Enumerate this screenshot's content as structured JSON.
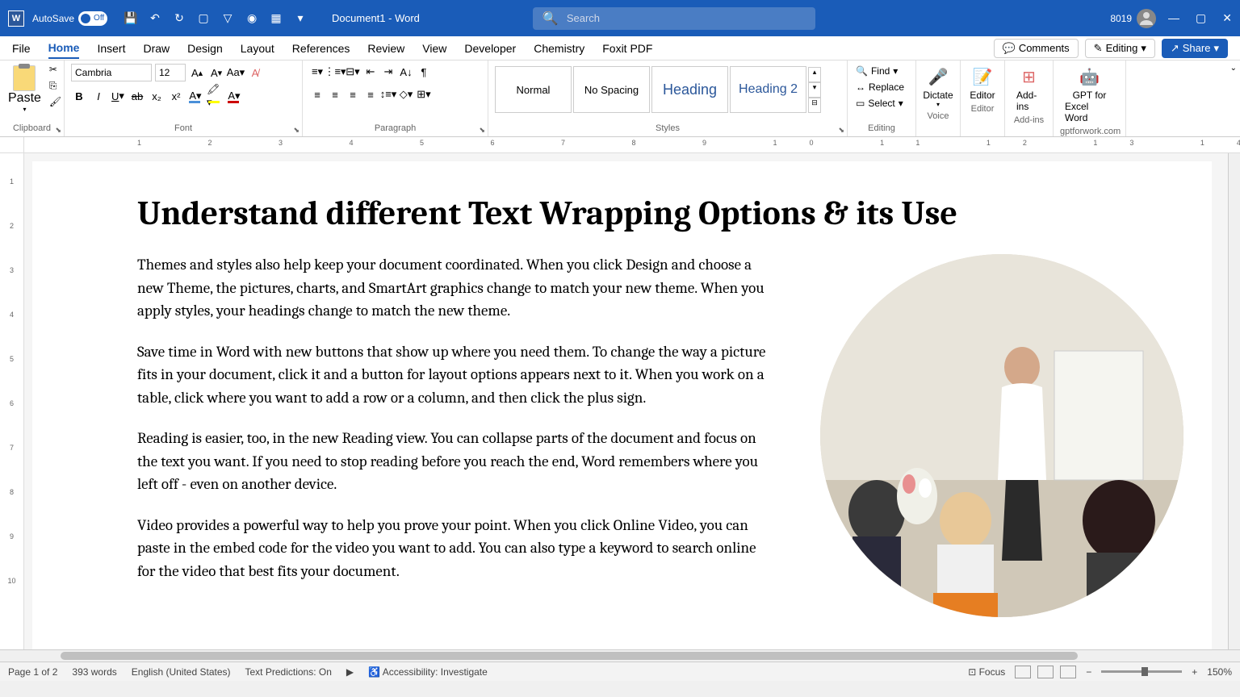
{
  "titlebar": {
    "autosave_label": "AutoSave",
    "autosave_state": "Off",
    "doc_title": "Document1 - Word",
    "search_placeholder": "Search",
    "user": "8019"
  },
  "tabs": {
    "items": [
      "File",
      "Home",
      "Insert",
      "Draw",
      "Design",
      "Layout",
      "References",
      "Review",
      "View",
      "Developer",
      "Chemistry",
      "Foxit PDF"
    ],
    "active": "Home",
    "comments": "Comments",
    "editing": "Editing",
    "share": "Share"
  },
  "ribbon": {
    "clipboard": {
      "label": "Clipboard",
      "paste": "Paste"
    },
    "font": {
      "label": "Font",
      "name": "Cambria",
      "size": "12"
    },
    "paragraph": {
      "label": "Paragraph"
    },
    "styles": {
      "label": "Styles",
      "normal": "Normal",
      "nospacing": "No Spacing",
      "heading1": "Heading",
      "heading2": "Heading 2"
    },
    "editing": {
      "label": "Editing",
      "find": "Find",
      "replace": "Replace",
      "select": "Select"
    },
    "voice": {
      "label": "Voice",
      "dictate": "Dictate"
    },
    "editor": {
      "label": "Editor",
      "btn": "Editor"
    },
    "addins": {
      "label": "Add-ins",
      "btn": "Add-ins"
    },
    "gpt": {
      "label": "gptforwork.com",
      "btn1": "GPT for",
      "btn2": "Excel Word"
    }
  },
  "document": {
    "title": "Understand different Text Wrapping Options & its Use",
    "p1": "Themes and styles also help keep your document coordinated. When you click Design and choose a new Theme, the pictures, charts, and SmartArt graphics change to match your new theme. When you apply styles, your headings change to match the new theme.",
    "p2": "Save time in Word with new buttons that show up where you need them. To change the way a picture fits in your document, click it and a button for layout options appears next to it. When you work on a table, click where you want to add a row or a column, and then click the plus sign.",
    "p3": "Reading is easier, too, in the new Reading view. You can collapse parts of the document and focus on the text you want. If you need to stop reading before you reach the end, Word remembers where you left off - even on another device.",
    "p4": "Video provides a powerful way to help you prove your point. When you click Online Video, you can paste in the embed code for the video you want to add. You can also type a keyword to search online for the video that best fits your document."
  },
  "statusbar": {
    "page": "Page 1 of 2",
    "words": "393 words",
    "lang": "English (United States)",
    "predictions": "Text Predictions: On",
    "accessibility": "Accessibility: Investigate",
    "focus": "Focus",
    "zoom": "150%"
  }
}
